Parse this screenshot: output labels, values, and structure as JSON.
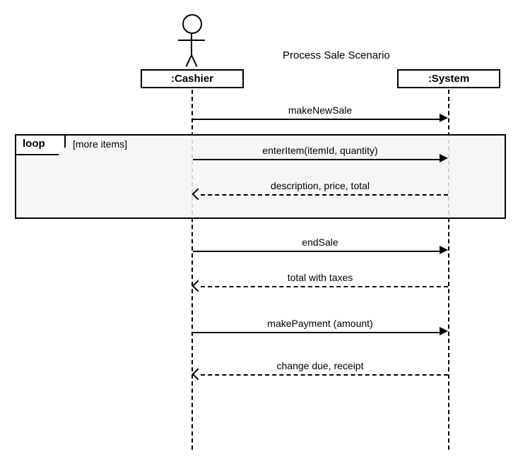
{
  "title": "Process Sale Scenario",
  "participants": {
    "cashier": ":Cashier",
    "system": ":System"
  },
  "loop": {
    "operator": "loop",
    "guard": "[more items]"
  },
  "messages": {
    "m1": "makeNewSale",
    "m2": "enterItem(itemId, quantity)",
    "m3": "description, price, total",
    "m4": "endSale",
    "m5": "total with taxes",
    "m6": "makePayment (amount)",
    "m7": "change due, receipt"
  }
}
